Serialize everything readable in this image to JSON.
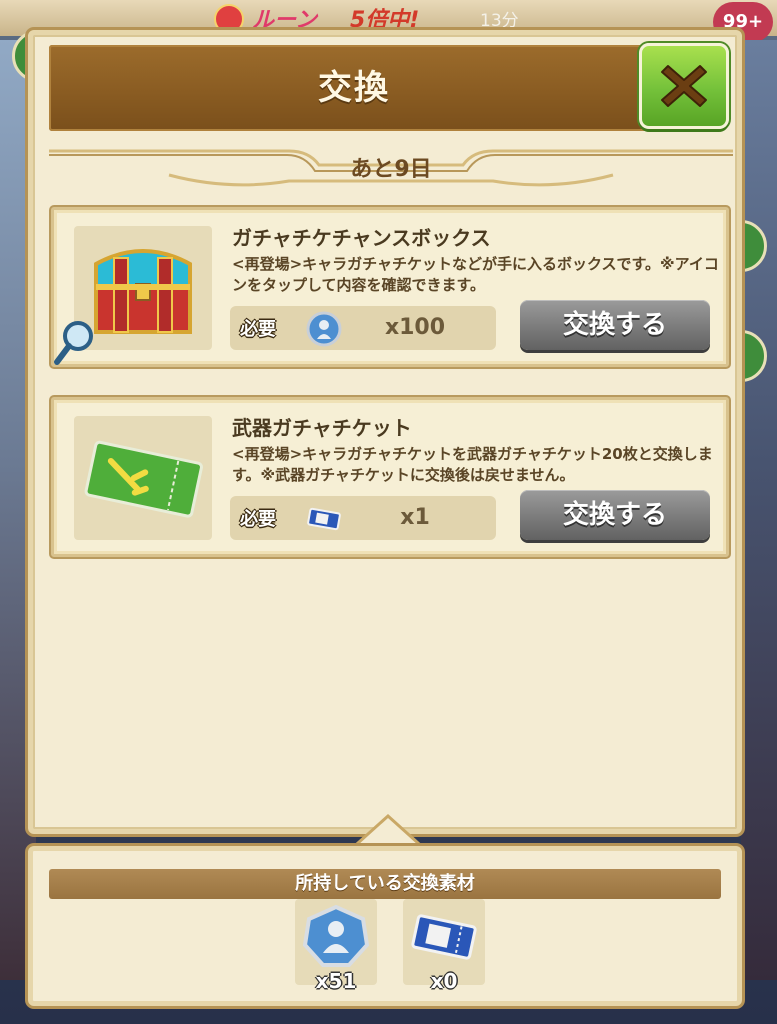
{
  "background": {
    "banner_rune": "ルーン",
    "banner_multiplier": "5倍中!",
    "banner_timer": "13分",
    "notification_badge": "99+"
  },
  "dialog": {
    "title": "交換",
    "close_icon": "close-x-icon",
    "remaining": "あと9日"
  },
  "items": [
    {
      "name": "ガチャチケチャンスボックス",
      "description": "<再登場>キャラガチャチケットなどが手に入るボックスです。※アイコンをタップして内容を確認できます。",
      "icon": "treasure-chest-icon",
      "required_label": "必要",
      "required_icon": "rune-medal-icon",
      "required_qty": "x100",
      "button_label": "交換する"
    },
    {
      "name": "武器ガチャチケット",
      "description": "<再登場>キャラガチャチケットを武器ガチャチケット20枚と交換します。※武器ガチャチケットに交換後は戻せません。",
      "icon": "weapon-gacha-ticket-icon",
      "required_label": "必要",
      "required_icon": "character-ticket-icon",
      "required_qty": "x1",
      "button_label": "交換する"
    }
  ],
  "owned_materials": {
    "header": "所持している交換素材",
    "items": [
      {
        "icon": "rune-medal-icon",
        "qty": "x51"
      },
      {
        "icon": "character-ticket-icon",
        "qty": "x0"
      }
    ]
  },
  "colors": {
    "header_brown": "#8a5c22",
    "close_green": "#74c13a",
    "button_gray": "#7b7b7b",
    "panel_cream": "#f4ecd3"
  }
}
